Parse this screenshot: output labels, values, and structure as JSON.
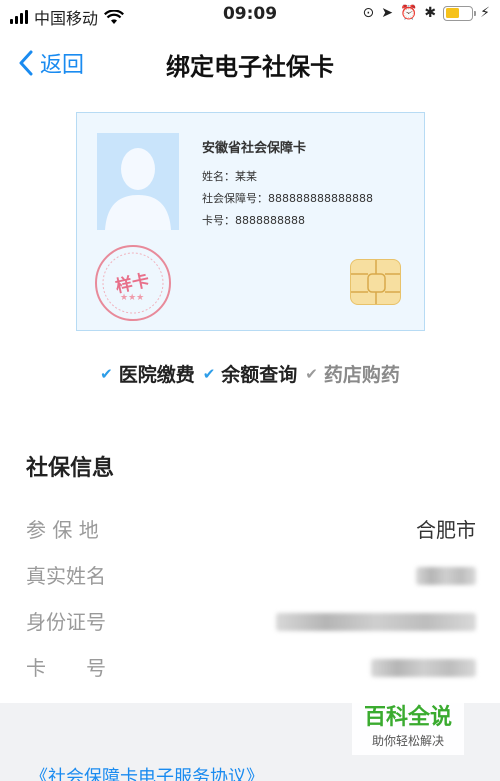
{
  "status_bar": {
    "carrier": "中国移动",
    "time": "09:09"
  },
  "nav": {
    "back_label": "返回",
    "title": "绑定电子社保卡"
  },
  "card": {
    "issuer": "安徽省社会保障卡",
    "name_line": "姓名：某某",
    "ss_number_line": "社会保障号：888888888888888",
    "card_number_line": "卡号：8888888888",
    "stamp_text": "样卡"
  },
  "features": [
    {
      "label": "医院缴费",
      "enabled": true
    },
    {
      "label": "余额查询",
      "enabled": true
    },
    {
      "label": "药店购药",
      "enabled": false
    }
  ],
  "info": {
    "title": "社保信息",
    "rows": [
      {
        "label": "参 保 地",
        "value": "合肥市"
      },
      {
        "label": "真实姓名",
        "value": ""
      },
      {
        "label": "身份证号",
        "value": ""
      },
      {
        "label": "卡　　号",
        "value": ""
      }
    ]
  },
  "agreement_link": "《社会保障卡电子服务协议》",
  "watermark": {
    "main": "百科全说",
    "sub": "助你轻松解决"
  },
  "colors": {
    "accent": "#1a8bf0",
    "check": "#2d9de8",
    "watermark_green": "#3aab2f"
  }
}
